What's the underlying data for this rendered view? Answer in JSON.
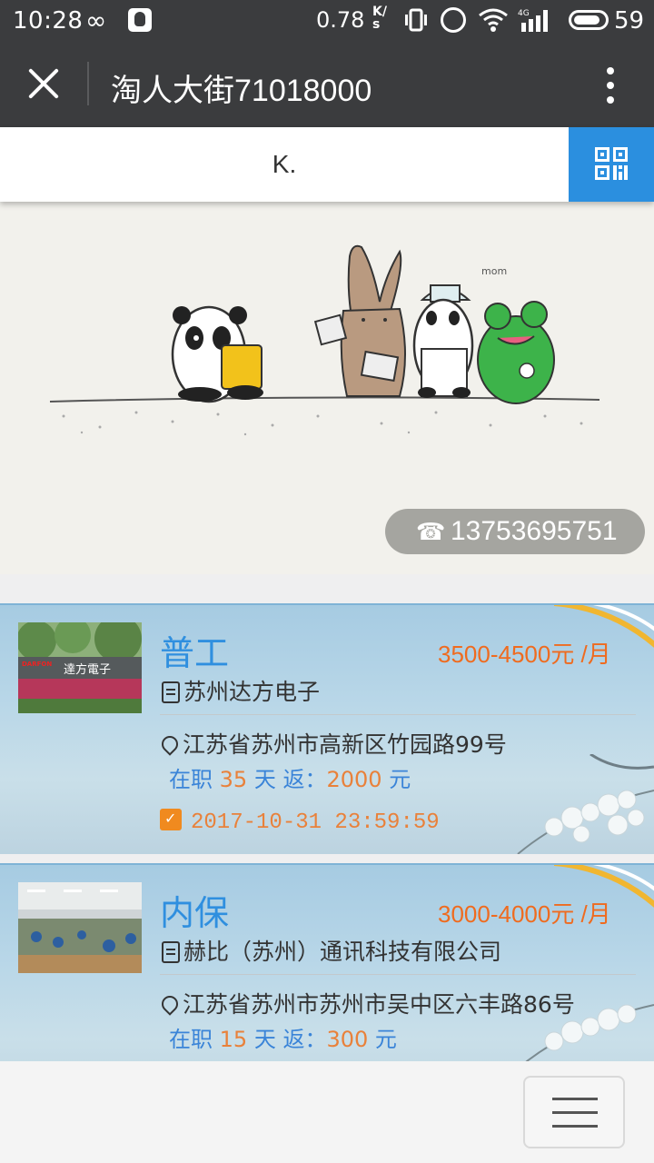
{
  "status_bar": {
    "time": "10:28",
    "network_speed": "0.78",
    "speed_unit_top": "K/",
    "speed_unit_bottom": "s",
    "network_type": "4G",
    "battery": "59",
    "icons": [
      "infinity-icon",
      "qq-icon",
      "vibrate-icon",
      "alarm-icon",
      "wifi-icon",
      "signal-icon",
      "battery-icon"
    ]
  },
  "header": {
    "title": "淘人大街71018000"
  },
  "search": {
    "value": "K."
  },
  "banner": {
    "phone": "13753695751"
  },
  "jobs": [
    {
      "title": "普工",
      "salary": "3500-4500元 /月",
      "company": "苏州达方电子",
      "address": "江苏省苏州市高新区竹园路99号",
      "bonus_prefix": "在职",
      "bonus_days": "35",
      "bonus_mid": "天 返：",
      "bonus_amount": "2000",
      "bonus_suffix": "元",
      "deadline": "2017-10-31 23:59:59",
      "photo_sign": "達方電子",
      "photo_logo": "DARFON"
    },
    {
      "title": "内保",
      "salary": "3000-4000元 /月",
      "company": "赫比（苏州）通讯科技有限公司",
      "address": "江苏省苏州市苏州市吴中区六丰路86号",
      "bonus_prefix": "在职",
      "bonus_days": "15",
      "bonus_mid": "天 返：",
      "bonus_amount": "300",
      "bonus_suffix": "元"
    }
  ],
  "colors": {
    "topbar": "#3b3c3e",
    "accent_blue": "#2b8fdf",
    "salary_orange": "#ef6b1f"
  }
}
